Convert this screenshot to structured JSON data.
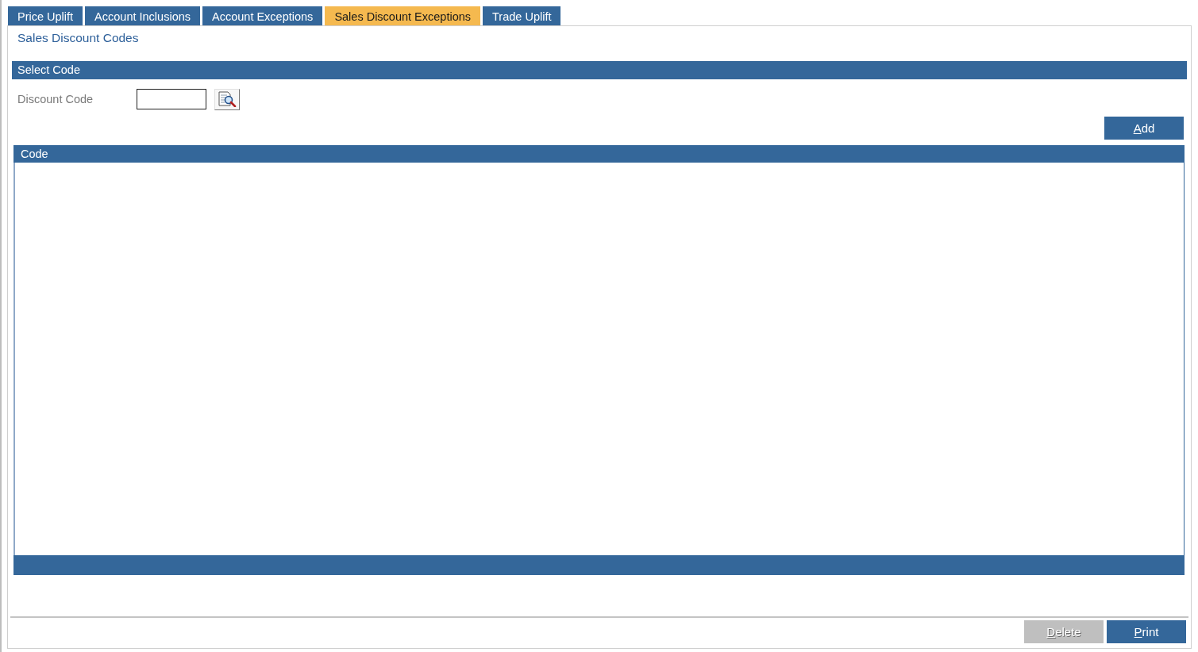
{
  "tabs": [
    {
      "label": "Price Uplift",
      "selected": false
    },
    {
      "label": "Account Inclusions",
      "selected": false
    },
    {
      "label": "Account Exceptions",
      "selected": false
    },
    {
      "label": "Sales Discount Exceptions",
      "selected": true
    },
    {
      "label": "Trade Uplift",
      "selected": false
    }
  ],
  "page_title": "Sales Discount Codes",
  "select_code": {
    "title": "Select Code",
    "field": {
      "label": "Discount Code"
    }
  },
  "add_button": {
    "label": "Add",
    "disabled": false
  },
  "grid": {
    "columns": [
      "Code"
    ]
  },
  "actions": [
    {
      "label": "Delete",
      "disabled": true
    },
    {
      "label": "Print",
      "disabled": false
    }
  ]
}
